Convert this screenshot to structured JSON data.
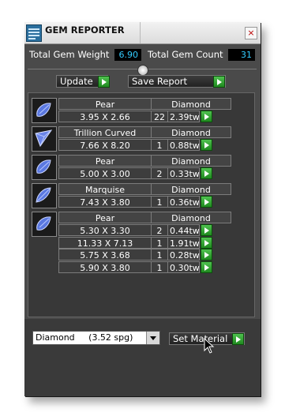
{
  "window": {
    "title": "GEM REPORTER",
    "close_label": "×"
  },
  "summary": {
    "weight_label": "Total Gem Weight",
    "weight_value": "6.90",
    "count_label": "Total Gem Count",
    "count_value": "31"
  },
  "toolbar": {
    "update_label": "Update",
    "save_label": "Save Report"
  },
  "gems": [
    {
      "shape": "Pear",
      "material": "Diamond",
      "icon": "pear-gem-icon",
      "rows": [
        {
          "size": "3.95 X 2.66",
          "qty": "22",
          "weight": "2.39tw"
        }
      ]
    },
    {
      "shape": "Trillion Curved",
      "material": "Diamond",
      "icon": "trillion-gem-icon",
      "rows": [
        {
          "size": "7.66 X 8.20",
          "qty": "1",
          "weight": "0.88tw"
        }
      ]
    },
    {
      "shape": "Pear",
      "material": "Diamond",
      "icon": "pear-gem-icon",
      "rows": [
        {
          "size": "5.00 X 3.00",
          "qty": "2",
          "weight": "0.33tw"
        }
      ]
    },
    {
      "shape": "Marquise",
      "material": "Diamond",
      "icon": "marquise-gem-icon",
      "rows": [
        {
          "size": "7.43 X 3.80",
          "qty": "1",
          "weight": "0.36tw"
        }
      ]
    },
    {
      "shape": "Pear",
      "material": "Diamond",
      "icon": "pear-gem-icon",
      "rows": [
        {
          "size": "5.30 X 3.30",
          "qty": "2",
          "weight": "0.44tw"
        },
        {
          "size": "11.33 X 7.13",
          "qty": "1",
          "weight": "1.91tw"
        },
        {
          "size": "5.75 X 3.68",
          "qty": "1",
          "weight": "0.28tw"
        },
        {
          "size": "5.90 X 3.80",
          "qty": "1",
          "weight": "0.30tw"
        }
      ]
    }
  ],
  "material_select": {
    "value": "Diamond     (3.52 spg)"
  },
  "set_material_label": "Set Material"
}
